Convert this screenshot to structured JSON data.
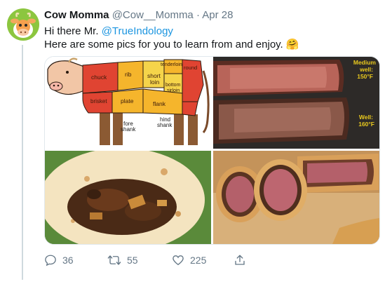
{
  "tweet": {
    "display_name": "Cow Momma",
    "handle": "@Cow__Momma",
    "separator": "·",
    "date": "Apr 28",
    "line1_prefix": "Hi there Mr. ",
    "mention": "@TrueIndology",
    "line2": "Here are some pics for you to learn from and enjoy.",
    "emoji": "🤗"
  },
  "cow_chart": {
    "labels": {
      "chuck": "chuck",
      "rib": "rib",
      "tenderloin": "tenderloin",
      "round": "round",
      "short_loin_1": "short",
      "short_loin_2": "loin",
      "bottom_1": "bottom",
      "bottom_2": "sirloin",
      "brisket": "brisket",
      "plate": "plate",
      "flank": "flank",
      "fore_1": "fore",
      "fore_2": "shank",
      "hind_1": "hind",
      "hind_2": "shank"
    }
  },
  "steak_photo": {
    "medium_1": "Medium",
    "medium_2": "well:",
    "medium_temp": "150°F",
    "well_1": "Well:",
    "well_temp": "160°F"
  },
  "actions": {
    "replies": "36",
    "retweets": "55",
    "likes": "225"
  },
  "colors": {
    "link": "#1b95e0",
    "muted": "#657786",
    "steak_label": "#e8c81e"
  }
}
